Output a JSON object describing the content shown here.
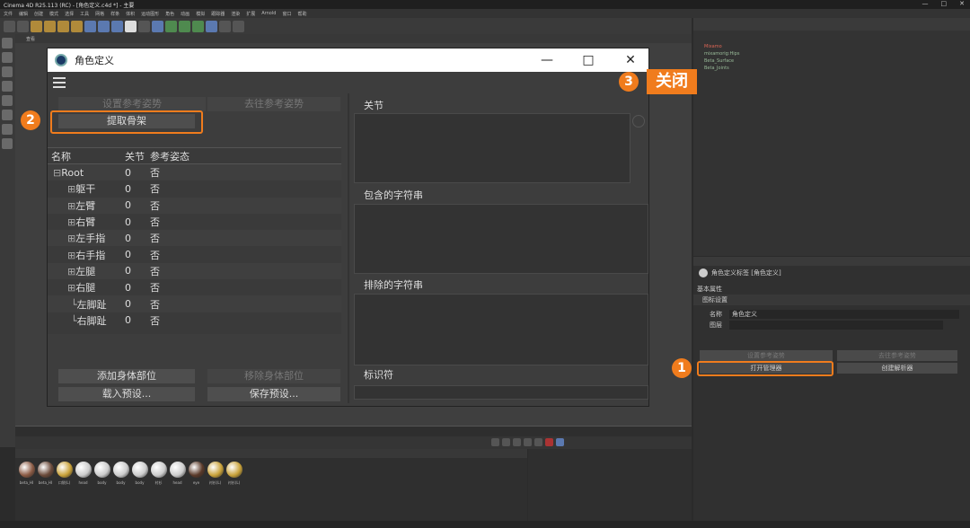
{
  "window": {
    "title": "Cinema 4D R25.113 (RC) - [角色定义.c4d *] - 主要"
  },
  "menu": [
    "文件",
    "编辑",
    "创建",
    "模式",
    "选择",
    "工具",
    "网格",
    "样条",
    "体积",
    "运动图形",
    "角色",
    "动画",
    "模拟",
    "跟踪器",
    "渲染",
    "扩展",
    "Arnold",
    "窗口",
    "帮助"
  ],
  "dialog": {
    "title": "角色定义",
    "btn_set_ref": "设置参考姿势",
    "btn_goto_ref": "去往参考姿势",
    "btn_extract": "提取骨架",
    "tree_headers": [
      "名称",
      "关节",
      "参考姿态"
    ],
    "tree_rows": [
      {
        "name": "Root",
        "joints": "0",
        "ref": "否"
      },
      {
        "name": "躯干",
        "joints": "0",
        "ref": "否"
      },
      {
        "name": "左臂",
        "joints": "0",
        "ref": "否"
      },
      {
        "name": "右臂",
        "joints": "0",
        "ref": "否"
      },
      {
        "name": "左手指",
        "joints": "0",
        "ref": "否"
      },
      {
        "name": "右手指",
        "joints": "0",
        "ref": "否"
      },
      {
        "name": "左腿",
        "joints": "0",
        "ref": "否"
      },
      {
        "name": "右腿",
        "joints": "0",
        "ref": "否"
      },
      {
        "name": "左脚趾",
        "joints": "0",
        "ref": "否"
      },
      {
        "name": "右脚趾",
        "joints": "0",
        "ref": "否"
      }
    ],
    "btn_add_body": "添加身体部位",
    "btn_remove_body": "移除身体部位",
    "btn_load_preset": "载入预设...",
    "btn_save_preset": "保存预设...",
    "sect_joints": "关节",
    "sect_include": "包含的字符串",
    "sect_exclude": "排除的字符串",
    "sect_identifier": "标识符"
  },
  "annotations": {
    "b1": "1",
    "b2": "2",
    "b3": "3",
    "close_label": "关闭"
  },
  "attr": {
    "title": "角色定义标签 [角色定义]",
    "basic": "基本属性",
    "icon": "图标设置",
    "name_label": "名称",
    "name_value": "角色定义",
    "layer_label": "图层",
    "btn_set_ref": "设置参考姿势",
    "btn_goto_ref": "去往参考姿势",
    "btn_open_mgr": "打开管理器",
    "btn_open_solver": "创建解析器"
  },
  "objects": [
    "Mixamo",
    "mixamorig:Hips",
    "Beta_Surface",
    "Beta_Joints"
  ],
  "materials": [
    "beta_HI",
    "beta_HI",
    "口袋(L)",
    "head",
    "body",
    "body",
    "body",
    "衬衫",
    "head",
    "eye",
    "衬衫(L)",
    "衬衫(L)"
  ],
  "colors": {
    "accent": "#f07c1d"
  }
}
